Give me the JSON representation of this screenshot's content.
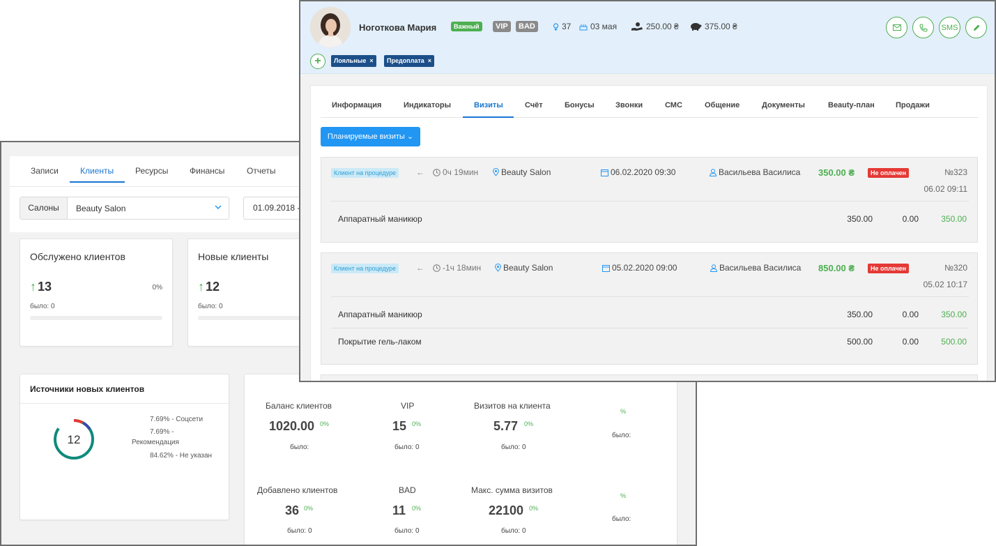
{
  "back_window": {
    "nav": [
      "Записи",
      "Клиенты",
      "Ресурсы",
      "Финансы",
      "Отчеты"
    ],
    "filter": {
      "salon_label": "Салоны",
      "salon_value": "Beauty Salon",
      "date_value": "01.09.2018 - ("
    },
    "cards": [
      {
        "title": "Обслужено клиентов",
        "value": "13",
        "pct": "0%",
        "was": "было: 0"
      },
      {
        "title": "Новые клиенты",
        "value": "12",
        "was": "было: 0"
      }
    ],
    "sources": {
      "title": "Источники новых клиентов",
      "total": "12",
      "legend": [
        "7.69% - Соцсети",
        "7.69% -",
        "Рекомендация",
        "84.62% - Не указан"
      ],
      "colors": {
        "main": "#0f8a7a",
        "social": "#e53935",
        "recommend": "#3949ab"
      }
    },
    "stats": [
      {
        "label": "Баланс клиентов",
        "value": "1020.00",
        "pct": "0%",
        "was": "было:"
      },
      {
        "label": "VIP",
        "value": "15",
        "pct": "0%",
        "was": "было: 0"
      },
      {
        "label": "Визитов на клиента",
        "value": "5.77",
        "pct": "0%",
        "was": "было: 0"
      },
      {
        "label": "",
        "value": "",
        "pct": "%",
        "was": "было:"
      },
      {
        "label": "Добавлено клиентов",
        "value": "36",
        "pct": "0%",
        "was": "было: 0"
      },
      {
        "label": "BAD",
        "value": "11",
        "pct": "0%",
        "was": "было: 0"
      },
      {
        "label": "Макс. сумма визитов",
        "value": "22100",
        "pct": "0%",
        "was": "было: 0"
      },
      {
        "label": "",
        "value": "",
        "pct": "%",
        "was": "было:"
      }
    ]
  },
  "front_window": {
    "client": {
      "name": "Ноготкова Мария",
      "badges": {
        "important": "Важный",
        "vip": "VIP",
        "bad": "BAD"
      },
      "age": "37",
      "birthday": "03 мая",
      "balance": "250.00 ₴",
      "savings": "375.00 ₴"
    },
    "actions": {
      "sms": "SMS"
    },
    "tags": [
      "Лояльные",
      "Предоплата"
    ],
    "tabs": [
      "Информация",
      "Индикаторы",
      "Визиты",
      "Счёт",
      "Бонусы",
      "Звонки",
      "СМС",
      "Общение",
      "Документы",
      "Beauty-план",
      "Продажи"
    ],
    "plan_button": "Планируемые визиты",
    "visits": [
      {
        "status": "Клиент на процедуре",
        "duration": "0ч 19мин",
        "location": "Beauty Salon",
        "datetime": "06.02.2020 09:30",
        "master": "Васильева Василиса",
        "sum": "350.00 ₴",
        "payment": "Не оплачен",
        "number": "№323",
        "stamp": "06.02 09:11",
        "services": [
          {
            "name": "Аппаратный маникюр",
            "price": "350.00",
            "discount": "0.00",
            "total": "350.00"
          }
        ]
      },
      {
        "status": "Клиент на процедуре",
        "duration": "-1ч 18мин",
        "location": "Beauty Salon",
        "datetime": "05.02.2020 09:00",
        "master": "Васильева Василиса",
        "sum": "850.00 ₴",
        "payment": "Не оплачен",
        "number": "№320",
        "stamp": "05.02 10:17",
        "services": [
          {
            "name": "Аппаратный маникюр",
            "price": "350.00",
            "discount": "0.00",
            "total": "350.00"
          },
          {
            "name": "Покрытие гель-лаком",
            "price": "500.00",
            "discount": "0.00",
            "total": "500.00"
          }
        ]
      }
    ]
  }
}
